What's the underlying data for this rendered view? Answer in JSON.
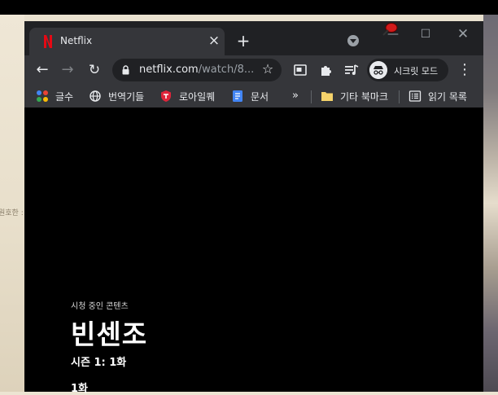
{
  "desktop": {
    "edge_text": "원호한 :"
  },
  "browser": {
    "tab": {
      "title": "Netflix",
      "favicon": "netflix-n-icon",
      "close_icon": "close-icon"
    },
    "new_tab_icon": "plus-icon",
    "toolbar": {
      "url_host": "netflix.com",
      "url_path": "/watch/8...",
      "incognito_label": "시크릿 모드"
    },
    "bookmarks": [
      {
        "label": "글수",
        "icon": "google-apps-icon"
      },
      {
        "label": "번역기들",
        "icon": "globe-icon"
      },
      {
        "label": "로아일퀘",
        "icon": "red-shield-icon"
      },
      {
        "label": "문서",
        "icon": "docs-icon"
      }
    ],
    "bookmarks_more": "»",
    "other_bookmarks": "기타 북마크",
    "reading_list": "읽기 목록"
  },
  "player": {
    "now_watching": "시청 중인 콘텐츠",
    "show_title": "빈센조",
    "season_episode": "시즌 1: 1화",
    "episode_title": "1화"
  },
  "colors": {
    "tabstrip": "#202124",
    "toolbar": "#35363a",
    "netflix_red": "#e50914",
    "video_bg": "#000000"
  }
}
